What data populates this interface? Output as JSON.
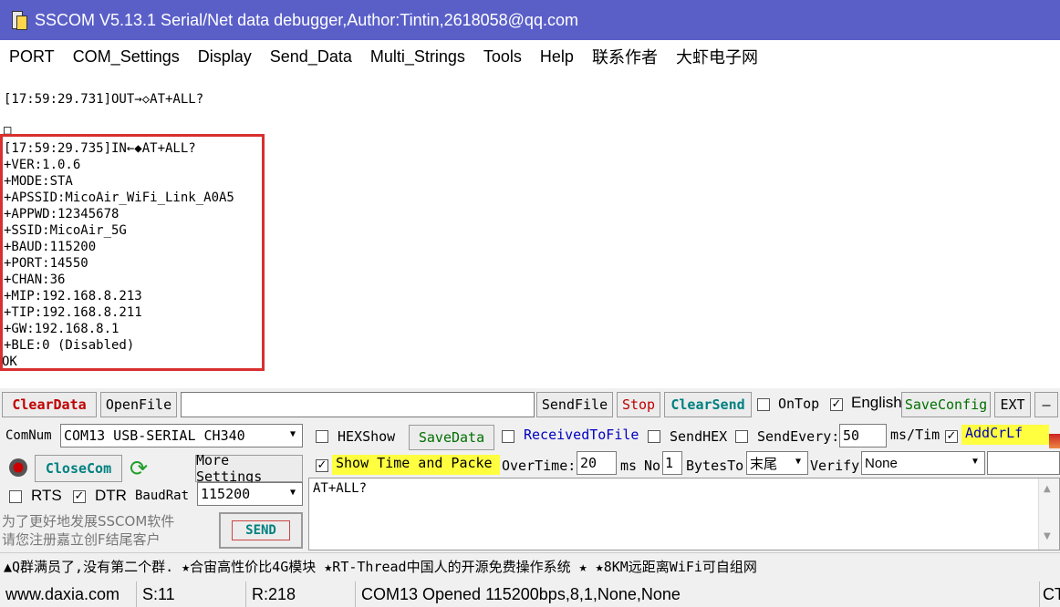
{
  "window": {
    "title": "SSCOM V5.13.1 Serial/Net data debugger,Author:Tintin,2618058@qq.com"
  },
  "menu": [
    "PORT",
    "COM_Settings",
    "Display",
    "Send_Data",
    "Multi_Strings",
    "Tools",
    "Help",
    "联系作者",
    "大虾电子网"
  ],
  "output": {
    "sent_line": "[17:59:29.731]OUT→◇AT+ALL?",
    "blank_glyph": "□",
    "response_lines": [
      "[17:59:29.735]IN←◆AT+ALL?",
      "+VER:1.0.6",
      "+MODE:STA",
      "+APSSID:MicoAir_WiFi_Link_A0A5",
      "+APPWD:12345678",
      "+SSID:MicoAir_5G",
      "+BAUD:115200",
      "+PORT:14550",
      "+CHAN:36",
      "+MIP:192.168.8.213",
      "+TIP:192.168.8.211",
      "+GW:192.168.8.1",
      "+BLE:0 (Disabled)"
    ],
    "ok_line": "OK"
  },
  "toolbar": {
    "clear_data": "ClearData",
    "open_file": "OpenFile",
    "file_path": "",
    "send_file": "SendFile",
    "stop": "Stop",
    "clear_send": "ClearSend",
    "on_top": "OnTop",
    "english": "English",
    "save_config": "SaveConfig",
    "ext": "EXT",
    "minus": "—"
  },
  "settings": {
    "com_num_label": "ComNum",
    "com_port": "COM13 USB-SERIAL CH340",
    "close_com": "CloseCom",
    "more_settings": "More Settings",
    "rts": "RTS",
    "dtr": "DTR",
    "baud_label": "BaudRat",
    "baud": "115200",
    "hex_show": "HEXShow",
    "save_data": "SaveData",
    "received_to_file": "ReceivedToFile",
    "send_hex": "SendHEX",
    "send_every": "SendEvery:",
    "send_every_value": "50",
    "ms_tim": "ms/Tim",
    "add_crlf": "AddCrLf",
    "show_time": "Show Time and Packe",
    "overtime": "OverTime:",
    "overtime_value": "20",
    "ms": "ms",
    "no": "No",
    "no_value": "1",
    "bytes_to": "BytesTo",
    "bytes_to_value": "末尾",
    "verify": "Verify",
    "verify_value": "None",
    "send_text": "AT+ALL?",
    "promo": "为了更好地发展SSCOM软件\n请您注册嘉立创F结尾客户",
    "send": "SEND"
  },
  "ticker": "▲Q群满员了,没有第二个群. ★合宙高性价比4G模块 ★RT-Thread中国人的开源免费操作系统 ★ ★8KM远距离WiFi可自组网",
  "status": {
    "site": "www.daxia.com",
    "sent": "S:11",
    "recv": "R:218",
    "port_state": "COM13 Opened  115200bps,8,1,None,None",
    "cts": "CT"
  },
  "colors": {
    "title_bar": "#5a5fc8",
    "highlight_box": "#d93030",
    "clear_data_text": "#c00000",
    "clear_send_text": "#008080",
    "save_text": "#007000",
    "received_text": "#0000c0",
    "yellow_highlight": "#ffff40"
  }
}
